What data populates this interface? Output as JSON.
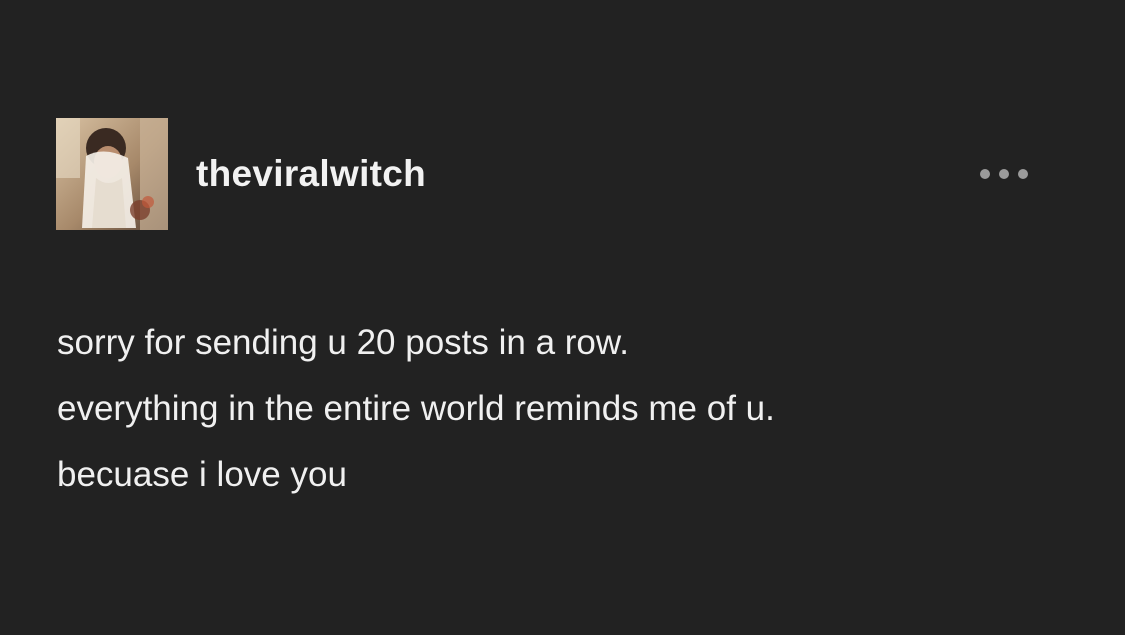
{
  "post": {
    "author": {
      "username": "theviralwitch",
      "avatar_icon": "profile-photo"
    },
    "menu_icon": "more-options-icon",
    "text_lines": [
      "sorry for sending u 20 posts in a row.",
      "everything in the entire world reminds me of u.",
      "becuase i love you"
    ]
  },
  "colors": {
    "background": "#222222",
    "text": "#f0f0f0",
    "icon": "#9b9b9b"
  }
}
